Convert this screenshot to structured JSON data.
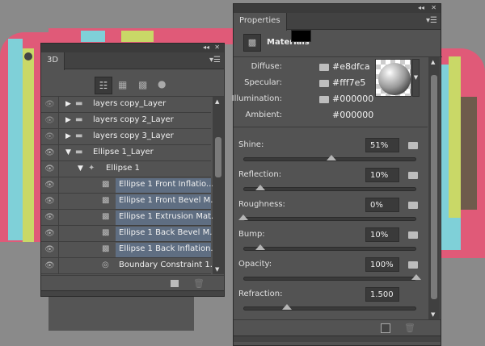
{
  "panel_3d": {
    "tab": "3D",
    "menu_icon": "panel-menu-icon",
    "filter_icons": [
      "scene-icon",
      "mesh-icon",
      "material-icon",
      "light-icon"
    ],
    "layers": [
      {
        "name": "layers copy_Layer",
        "type": "folder",
        "expanded": false,
        "level": 0,
        "selected": false
      },
      {
        "name": "layers copy 2_Layer",
        "type": "folder",
        "expanded": false,
        "level": 0,
        "selected": false
      },
      {
        "name": "layers copy 3_Layer",
        "type": "folder",
        "expanded": false,
        "level": 0,
        "selected": false
      },
      {
        "name": "Ellipse 1_Layer",
        "type": "folder",
        "expanded": true,
        "level": 0,
        "selected": false
      },
      {
        "name": "Ellipse 1",
        "type": "mesh",
        "expanded": true,
        "level": 1,
        "selected": false
      },
      {
        "name": "Ellipse 1 Front Inflatio...",
        "type": "material",
        "level": 2,
        "selected": true
      },
      {
        "name": "Ellipse 1 Front Bevel M...",
        "type": "material",
        "level": 2,
        "selected": true
      },
      {
        "name": "Ellipse 1 Extrusion Mat...",
        "type": "material",
        "level": 2,
        "selected": true
      },
      {
        "name": "Ellipse 1 Back Bevel M...",
        "type": "material",
        "level": 2,
        "selected": true
      },
      {
        "name": "Ellipse 1 Back Inflation...",
        "type": "material",
        "level": 2,
        "selected": true
      },
      {
        "name": "Boundary Constraint 1...",
        "type": "constraint",
        "level": 2,
        "selected": false
      }
    ]
  },
  "properties": {
    "tab": "Properties",
    "section": "Materials",
    "colors": [
      {
        "label": "Diffuse:",
        "hex": "#e8dfca",
        "swatch": "#e8dfca",
        "folder": true
      },
      {
        "label": "Specular:",
        "hex": "#fff7e5",
        "swatch": "#fff7e5",
        "folder": true
      },
      {
        "label": "Illumination:",
        "hex": "#000000",
        "swatch": "#000000",
        "folder": true
      },
      {
        "label": "Ambient:",
        "hex": "#000000",
        "swatch": "#000000",
        "folder": false
      }
    ],
    "sliders": [
      {
        "label": "Shine:",
        "value": "51%",
        "fraction": 0.51,
        "folder": true
      },
      {
        "label": "Reflection:",
        "value": "10%",
        "fraction": 0.1,
        "folder": true
      },
      {
        "label": "Roughness:",
        "value": "0%",
        "fraction": 0.0,
        "folder": true
      },
      {
        "label": "Bump:",
        "value": "10%",
        "fraction": 0.1,
        "folder": true
      },
      {
        "label": "Opacity:",
        "value": "100%",
        "fraction": 1.0,
        "folder": true
      },
      {
        "label": "Refraction:",
        "value": "1.500",
        "fraction": 0.25,
        "folder": false
      }
    ]
  }
}
